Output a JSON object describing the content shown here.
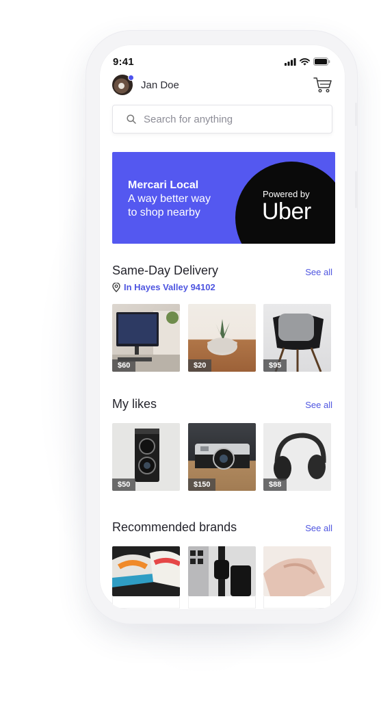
{
  "status_bar": {
    "time": "9:41"
  },
  "header": {
    "user_name": "Jan Doe"
  },
  "search": {
    "placeholder": "Search for anything"
  },
  "banner": {
    "title": "Mercari Local",
    "subtitle_line1": "A way better way",
    "subtitle_line2": "to shop nearby",
    "powered_by": "Powered by",
    "partner": "Uber"
  },
  "same_day": {
    "title": "Same-Day Delivery",
    "see_all": "See all",
    "location": "In Hayes Valley 94102",
    "items": [
      {
        "name": "monitor",
        "price": "$60"
      },
      {
        "name": "plant",
        "price": "$20"
      },
      {
        "name": "chair",
        "price": "$95"
      }
    ]
  },
  "likes": {
    "title": "My likes",
    "see_all": "See all",
    "items": [
      {
        "name": "twin-lens-camera",
        "price": "$50"
      },
      {
        "name": "rangefinder-camera",
        "price": "$150"
      },
      {
        "name": "headphones",
        "price": "$88"
      }
    ]
  },
  "brands": {
    "title": "Recommended brands",
    "see_all": "See all"
  },
  "colors": {
    "accent": "#4e55e0",
    "banner": "#5458f0"
  }
}
